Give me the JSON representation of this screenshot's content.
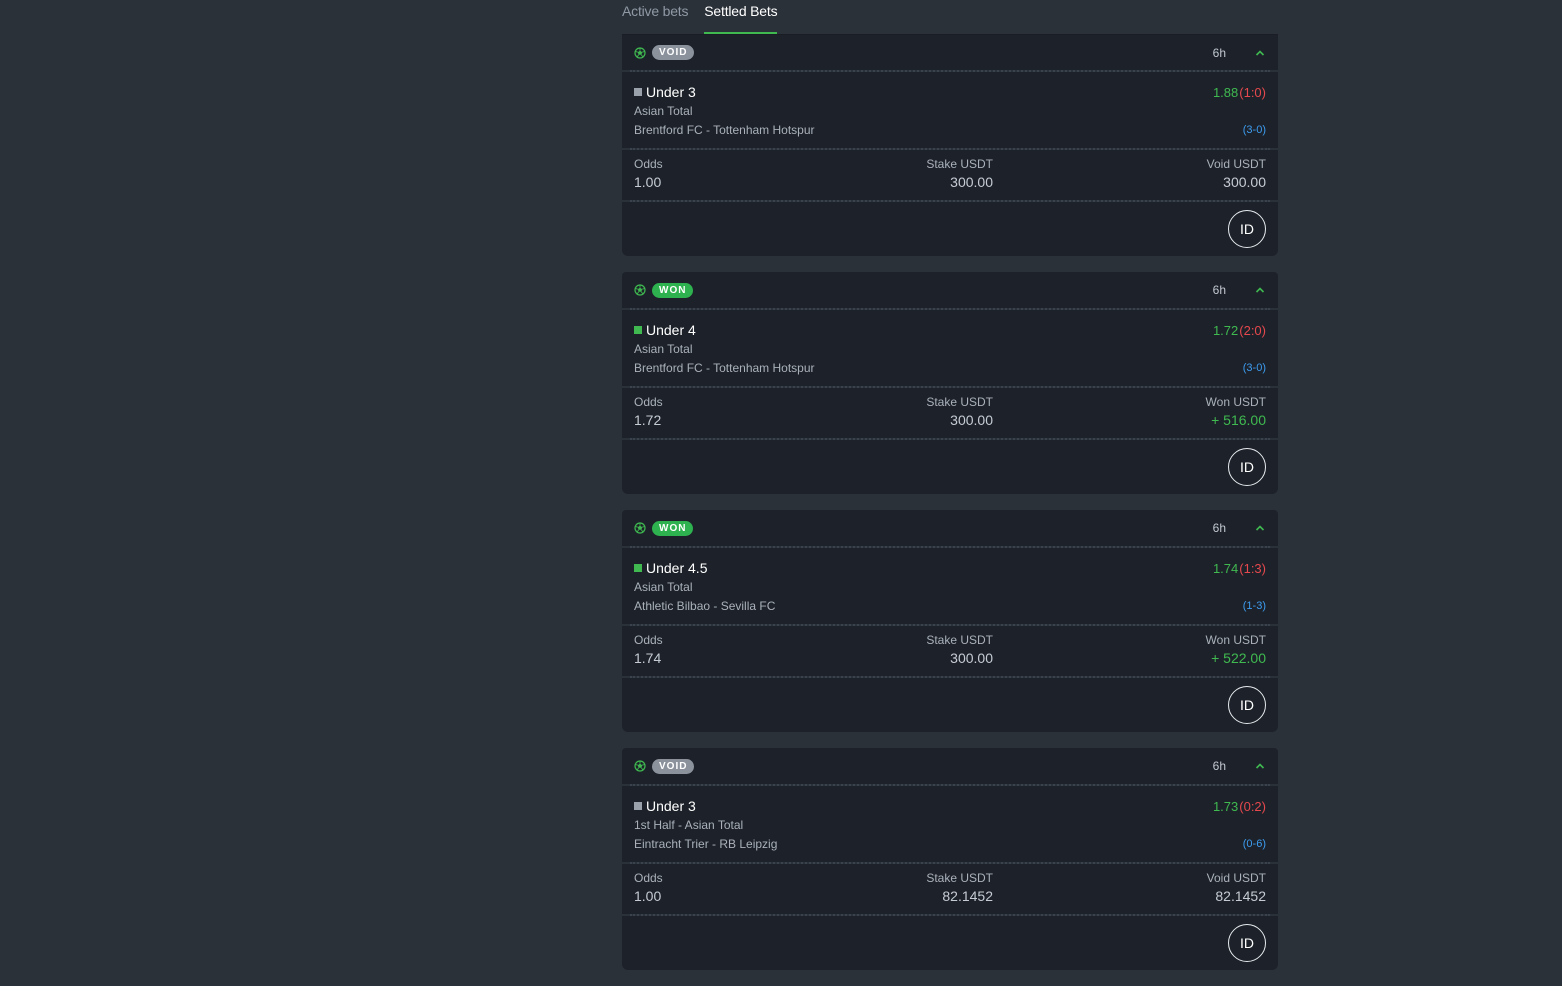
{
  "tabs": [
    {
      "label": "Active bets",
      "active": false
    },
    {
      "label": "Settled Bets",
      "active": true
    }
  ],
  "colors": {
    "accent": "#3fb950",
    "void_badge": "#8b929c",
    "won_badge": "#2eb24f",
    "score_red": "#e5484d",
    "final_blue": "#3d9cf0"
  },
  "bets": [
    {
      "status": "VOID",
      "time": "6h",
      "pick": "Under 3",
      "price": "1.88",
      "score_at_bet": "(1:0)",
      "market": "Asian Total",
      "event": "Brentford FC - Tottenham Hotspur",
      "final_score": "(3-0)",
      "odds_label": "Odds",
      "odds_value": "1.00",
      "stake_label": "Stake USDT",
      "stake_value": "300.00",
      "result_label": "Void USDT",
      "result_value": "300.00",
      "id_label": "ID"
    },
    {
      "status": "WON",
      "time": "6h",
      "pick": "Under 4",
      "price": "1.72",
      "score_at_bet": "(2:0)",
      "market": "Asian Total",
      "event": "Brentford FC - Tottenham Hotspur",
      "final_score": "(3-0)",
      "odds_label": "Odds",
      "odds_value": "1.72",
      "stake_label": "Stake USDT",
      "stake_value": "300.00",
      "result_label": "Won USDT",
      "result_value": "+ 516.00",
      "id_label": "ID"
    },
    {
      "status": "WON",
      "time": "6h",
      "pick": "Under 4.5",
      "price": "1.74",
      "score_at_bet": "(1:3)",
      "market": "Asian Total",
      "event": "Athletic Bilbao - Sevilla FC",
      "final_score": "(1-3)",
      "odds_label": "Odds",
      "odds_value": "1.74",
      "stake_label": "Stake USDT",
      "stake_value": "300.00",
      "result_label": "Won USDT",
      "result_value": "+ 522.00",
      "id_label": "ID"
    },
    {
      "status": "VOID",
      "time": "6h",
      "pick": "Under 3",
      "price": "1.73",
      "score_at_bet": "(0:2)",
      "market": "1st Half - Asian Total",
      "event": "Eintracht Trier - RB Leipzig",
      "final_score": "(0-6)",
      "odds_label": "Odds",
      "odds_value": "1.00",
      "stake_label": "Stake USDT",
      "stake_value": "82.1452",
      "result_label": "Void USDT",
      "result_value": "82.1452",
      "id_label": "ID"
    }
  ]
}
